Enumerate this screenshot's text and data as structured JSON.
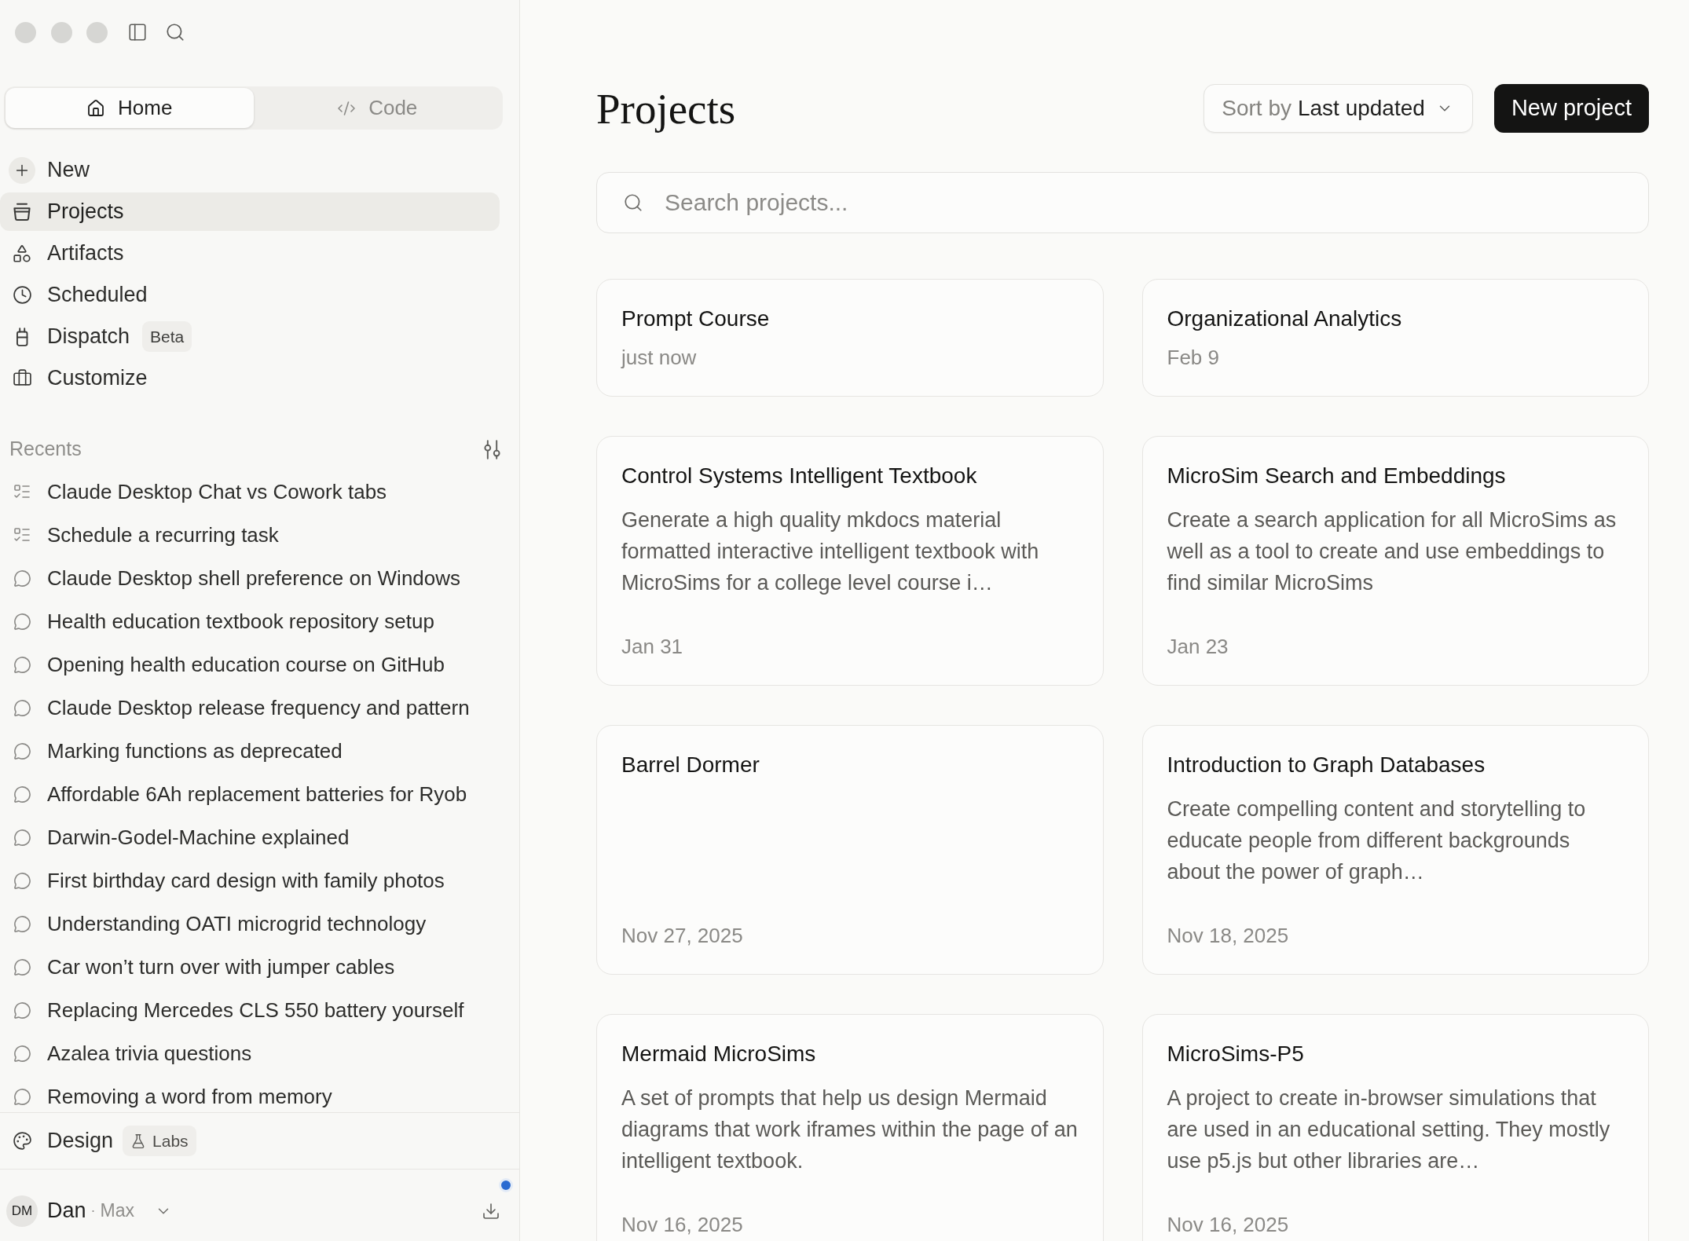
{
  "sidebar": {
    "tabs": [
      {
        "label": "Home",
        "selected": true
      },
      {
        "label": "Code",
        "selected": false
      }
    ],
    "nav": [
      {
        "label": "New",
        "selected": false
      },
      {
        "label": "Projects",
        "selected": true
      },
      {
        "label": "Artifacts",
        "selected": false
      },
      {
        "label": "Scheduled",
        "selected": false
      },
      {
        "label": "Dispatch",
        "badge": "Beta",
        "selected": false
      },
      {
        "label": "Customize",
        "selected": false
      }
    ],
    "recents": {
      "title": "Recents",
      "items": [
        {
          "label": "Claude Desktop Chat vs Cowork tabs",
          "kind": "task"
        },
        {
          "label": "Schedule a recurring task",
          "kind": "task"
        },
        {
          "label": "Claude Desktop shell preference on Windows",
          "kind": "chat"
        },
        {
          "label": "Health education textbook repository setup",
          "kind": "chat"
        },
        {
          "label": "Opening health education course on GitHub",
          "kind": "chat"
        },
        {
          "label": "Claude Desktop release frequency and pattern",
          "kind": "chat"
        },
        {
          "label": "Marking functions as deprecated",
          "kind": "chat"
        },
        {
          "label": "Affordable 6Ah replacement batteries for Ryob",
          "kind": "chat"
        },
        {
          "label": "Darwin-Godel-Machine explained",
          "kind": "chat"
        },
        {
          "label": "First birthday card design with family photos",
          "kind": "chat"
        },
        {
          "label": "Understanding OATI microgrid technology",
          "kind": "chat"
        },
        {
          "label": "Car won’t turn over with jumper cables",
          "kind": "chat"
        },
        {
          "label": "Replacing Mercedes CLS 550 battery yourself",
          "kind": "chat"
        },
        {
          "label": "Azalea trivia questions",
          "kind": "chat"
        },
        {
          "label": "Removing a word from memory",
          "kind": "chat"
        }
      ]
    },
    "design": {
      "label": "Design",
      "badge": "Labs"
    },
    "user": {
      "initials": "DM",
      "name": "Dan",
      "separator": "·",
      "plan": "Max",
      "update_available": true
    }
  },
  "main": {
    "title": "Projects",
    "sort": {
      "prefix": "Sort by",
      "value": "Last updated"
    },
    "new_button": "New project",
    "search": {
      "placeholder": "Search projects..."
    },
    "projects": [
      {
        "title": "Prompt Course",
        "date": "just now"
      },
      {
        "title": "Organizational Analytics",
        "date": "Feb 9"
      },
      {
        "title": "Control Systems Intelligent Textbook",
        "description": "Generate a high quality mkdocs material formatted interactive intelligent textbook with MicroSims for a college level course i…",
        "date": "Jan 31"
      },
      {
        "title": "MicroSim Search and Embeddings",
        "description": "Create a search application for all MicroSims as well as a tool to create and use embeddings to find similar MicroSims",
        "date": "Jan 23"
      },
      {
        "title": "Barrel Dormer",
        "date": "Nov 27, 2025"
      },
      {
        "title": "Introduction to Graph Databases",
        "description": "Create compelling content and storytelling to educate people from different backgrounds about the power of graph…",
        "date": "Nov 18, 2025"
      },
      {
        "title": "Mermaid MicroSims",
        "description": "A set of prompts that help us design Mermaid diagrams that work iframes within the page of an intelligent textbook.",
        "date": "Nov 16, 2025"
      },
      {
        "title": "MicroSims-P5",
        "description": "A project to create in-browser simulations that are used in an educational setting. They mostly use p5.js but other libraries are…",
        "date": "Nov 16, 2025"
      }
    ]
  }
}
